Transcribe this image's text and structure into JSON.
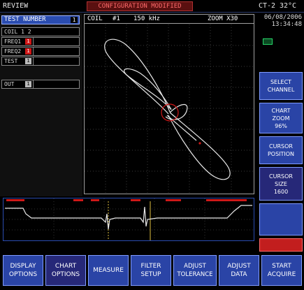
{
  "topbar": {
    "mode": "REVIEW",
    "warning": "CONFIGURATION MODIFIED",
    "instrument": "CT-2",
    "temperature": "32°C"
  },
  "left_panel": {
    "header_label": "TEST NUMBER",
    "header_value": "1",
    "coil_row": "COIL  1 2",
    "freq1_label": "FREQ1",
    "freq1_val": "1",
    "freq2_label": "FREQ2",
    "freq2_val": "1",
    "test_label": "TEST",
    "test_val": "1",
    "out_label": "OUT",
    "out_val": "1"
  },
  "scope": {
    "coil": "COIL",
    "coil_num": "#1",
    "frequency": "150 kHz",
    "zoom": "ZOOM X30"
  },
  "datetime": {
    "date": "06/08/2006",
    "time": "13:34:48"
  },
  "side_buttons": [
    {
      "line1": "SELECT",
      "line2": "CHANNEL",
      "line3": ""
    },
    {
      "line1": "CHART",
      "line2": "ZOOM",
      "line3": "96%"
    },
    {
      "line1": "CURSOR",
      "line2": "POSITION",
      "line3": ""
    },
    {
      "line1": "CURSOR",
      "line2": "SIZE",
      "line3": "1600"
    }
  ],
  "bottom_buttons": [
    {
      "line1": "DISPLAY",
      "line2": "OPTIONS"
    },
    {
      "line1": "CHART",
      "line2": "OPTIONS"
    },
    {
      "line1": "MEASURE",
      "line2": ""
    },
    {
      "line1": "FILTER",
      "line2": "SETUP"
    },
    {
      "line1": "ADJUST",
      "line2": "TOLERANCE"
    },
    {
      "line1": "ADJUST",
      "line2": "DATA"
    },
    {
      "line1": "START",
      "line2": "ACQUIRE"
    }
  ],
  "colors": {
    "panel_blue": "#2a44a6",
    "active_blue": "#262878",
    "alarm_red": "#c21e1e",
    "trace": "#e8e8e8",
    "marker_red": "#d01818"
  }
}
